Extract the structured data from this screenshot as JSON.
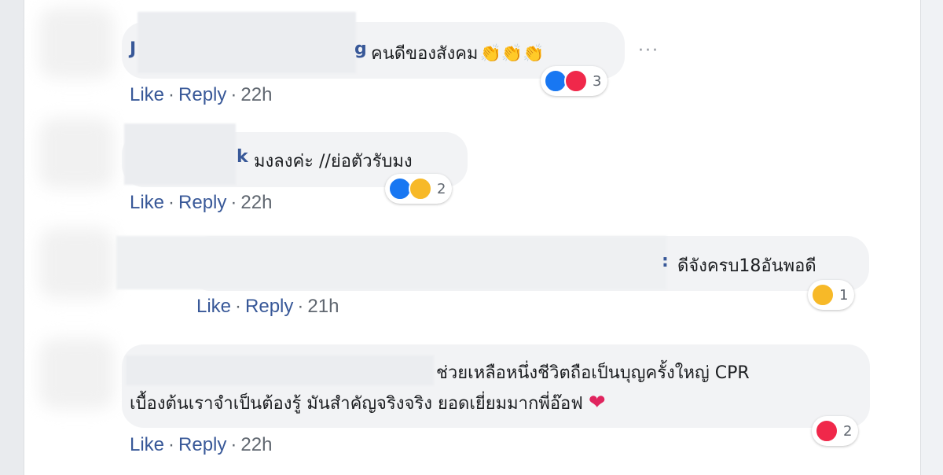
{
  "comments": [
    {
      "name_visible_start": "J",
      "name_visible_end": "g",
      "text": "คนดีของสังคม",
      "emoji": "👏👏👏",
      "actions": {
        "like": "Like",
        "reply": "Reply",
        "time": "22h"
      },
      "reaction_count": "3",
      "reactions": [
        "like-icon",
        "love-icon"
      ]
    },
    {
      "name_visible_end": "k",
      "text": "มงลงค่ะ //ย่อตัวรับมง",
      "actions": {
        "like": "Like",
        "reply": "Reply",
        "time": "22h"
      },
      "reaction_count": "2",
      "reactions": [
        "like-icon",
        "haha-icon"
      ]
    },
    {
      "name_visible_end": ":",
      "text": "ดีจังครบ18อันพอดี",
      "actions": {
        "like": "Like",
        "reply": "Reply",
        "time": "21h"
      },
      "reaction_count": "1",
      "reactions": [
        "haha-icon"
      ]
    },
    {
      "text_line1": "ช่วยเหลือหนึ่งชีวิตถือเป็นบุญครั้งใหญ่ CPR",
      "text_line2": "เบื้องต้นเราจำเป็นต้องรู้ มันสำคัญจริงจริง ยอดเยี่ยมมากพี่อ๊อฟ",
      "heart": "❤",
      "actions": {
        "like": "Like",
        "reply": "Reply",
        "time": "22h"
      },
      "reaction_count": "2",
      "reactions": [
        "love-icon"
      ]
    }
  ],
  "more_options": "···",
  "sep": "·",
  "colors": {
    "link": "#385898",
    "bubble": "#f2f3f5",
    "like": "#1877f2",
    "love": "#f0284a",
    "haha": "#f7b928"
  }
}
